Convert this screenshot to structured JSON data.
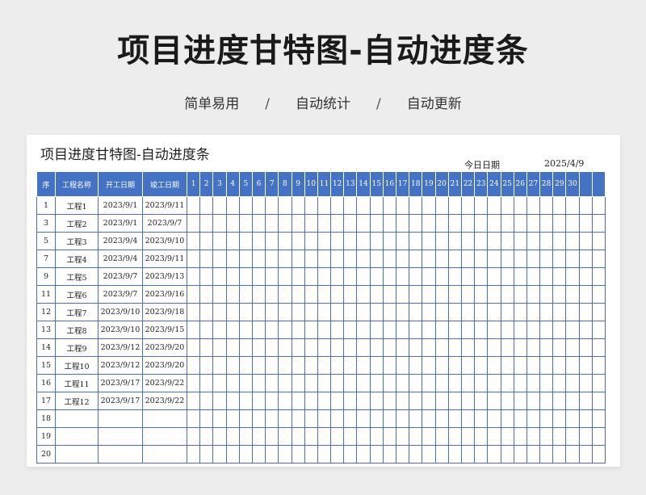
{
  "page": {
    "title": "项目进度甘特图-自动进度条",
    "subtitle_items": [
      "简单易用",
      "自动统计",
      "自动更新"
    ],
    "subtitle_separator": "/"
  },
  "sheet": {
    "title": "项目进度甘特图-自动进度条",
    "today_label": "今日日期",
    "today_value": "2025/4/9",
    "headers": {
      "seq": "序",
      "name": "工程名称",
      "start": "开工日期",
      "end": "竣工日期",
      "days": [
        "1",
        "2",
        "3",
        "4",
        "5",
        "6",
        "7",
        "8",
        "9",
        "10",
        "11",
        "12",
        "13",
        "14",
        "15",
        "16",
        "17",
        "18",
        "19",
        "20",
        "21",
        "22",
        "23",
        "24",
        "25",
        "26",
        "27",
        "28",
        "29",
        "30",
        "",
        ""
      ]
    },
    "rows": [
      {
        "seq": "1",
        "name": "工程1",
        "start": "2023/9/1",
        "end": "2023/9/11"
      },
      {
        "seq": "3",
        "name": "工程2",
        "start": "2023/9/1",
        "end": "2023/9/7"
      },
      {
        "seq": "5",
        "name": "工程3",
        "start": "2023/9/4",
        "end": "2023/9/10"
      },
      {
        "seq": "7",
        "name": "工程4",
        "start": "2023/9/4",
        "end": "2023/9/11"
      },
      {
        "seq": "9",
        "name": "工程5",
        "start": "2023/9/7",
        "end": "2023/9/13"
      },
      {
        "seq": "11",
        "name": "工程6",
        "start": "2023/9/7",
        "end": "2023/9/16"
      },
      {
        "seq": "12",
        "name": "工程7",
        "start": "2023/9/10",
        "end": "2023/9/18"
      },
      {
        "seq": "13",
        "name": "工程8",
        "start": "2023/9/10",
        "end": "2023/9/15"
      },
      {
        "seq": "14",
        "name": "工程9",
        "start": "2023/9/12",
        "end": "2023/9/20"
      },
      {
        "seq": "15",
        "name": "工程10",
        "start": "2023/9/12",
        "end": "2023/9/20"
      },
      {
        "seq": "16",
        "name": "工程11",
        "start": "2023/9/17",
        "end": "2023/9/22"
      },
      {
        "seq": "17",
        "name": "工程12",
        "start": "2023/9/17",
        "end": "2023/9/22"
      },
      {
        "seq": "18",
        "name": "",
        "start": "",
        "end": ""
      },
      {
        "seq": "19",
        "name": "",
        "start": "",
        "end": ""
      },
      {
        "seq": "20",
        "name": "",
        "start": "",
        "end": ""
      }
    ]
  },
  "colors": {
    "header_bg": "#4472c4",
    "grid_line": "#4a6fc4",
    "page_bg": "#ededed"
  }
}
